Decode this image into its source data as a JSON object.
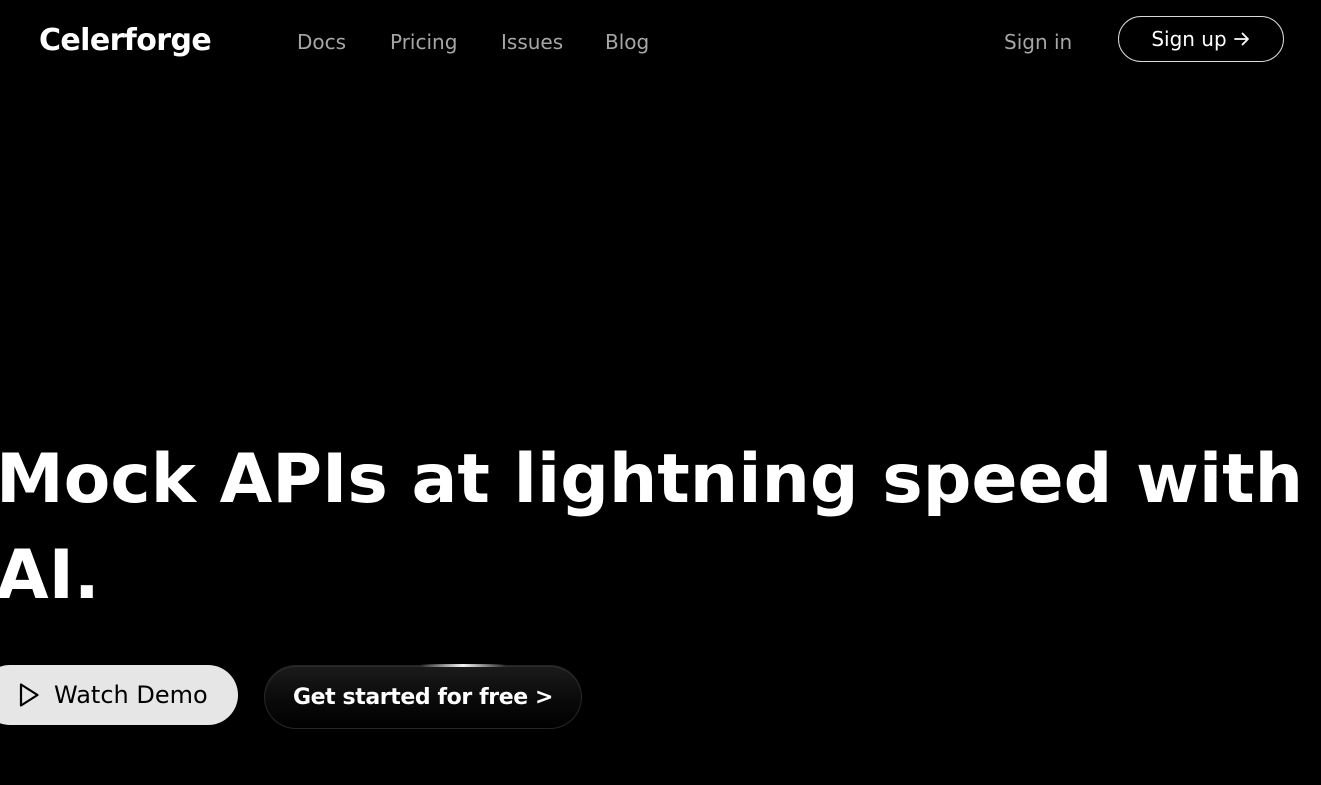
{
  "brand": {
    "name": "Celerforge"
  },
  "nav": {
    "links": [
      {
        "label": "Docs"
      },
      {
        "label": "Pricing"
      },
      {
        "label": "Issues"
      },
      {
        "label": "Blog"
      }
    ],
    "signin_label": "Sign in",
    "signup_label": "Sign up",
    "signup_icon": "arrow-right-icon"
  },
  "hero": {
    "title": "Mock APIs at lightning speed with AI.",
    "watch_demo_label": "Watch Demo",
    "watch_demo_icon": "play-icon",
    "get_started_label": "Get started for free >"
  },
  "colors": {
    "background": "#000000",
    "text_primary": "#ffffff",
    "nav_muted": "#a6a6a6",
    "watch_button_bg": "#e6e6e6"
  }
}
